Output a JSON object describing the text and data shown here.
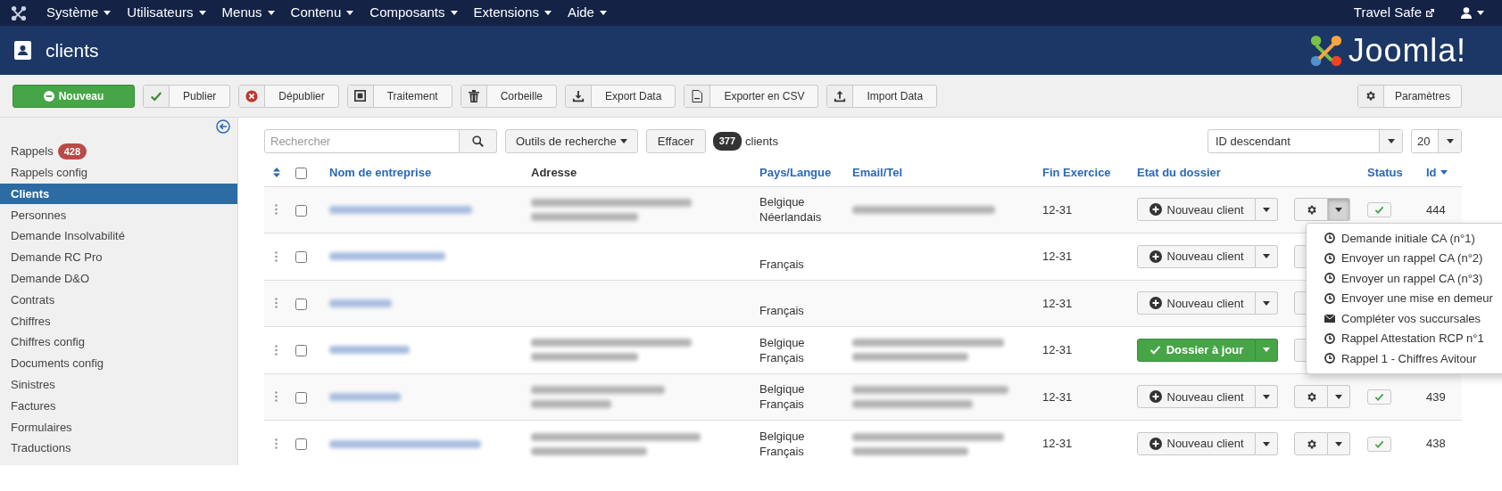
{
  "topnav": {
    "menus": [
      "Système",
      "Utilisateurs",
      "Menus",
      "Contenu",
      "Composants",
      "Extensions",
      "Aide"
    ],
    "site_link": "Travel Safe"
  },
  "header": {
    "title": "clients",
    "logo_text": "Joomla!"
  },
  "toolbar": {
    "buttons": [
      {
        "kind": "new",
        "label": "Nouveau"
      },
      {
        "kind": "publish",
        "label": "Publier"
      },
      {
        "kind": "unpublish",
        "label": "Dépublier"
      },
      {
        "kind": "batch",
        "label": "Traitement"
      },
      {
        "kind": "trash",
        "label": "Corbeille"
      },
      {
        "kind": "download",
        "label": "Export Data"
      },
      {
        "kind": "file",
        "label": "Exporter en CSV"
      },
      {
        "kind": "upload",
        "label": "Import Data"
      }
    ],
    "options": "Paramètres"
  },
  "sidebar": {
    "items": [
      {
        "label": "Rappels",
        "badge": "428",
        "selected": false
      },
      {
        "label": "Rappels config",
        "selected": false
      },
      {
        "label": "Clients",
        "selected": true
      },
      {
        "label": "Personnes",
        "selected": false
      },
      {
        "label": "Demande Insolvabilité",
        "selected": false
      },
      {
        "label": "Demande RC Pro",
        "selected": false
      },
      {
        "label": "Demande D&O",
        "selected": false
      },
      {
        "label": "Contrats",
        "selected": false
      },
      {
        "label": "Chiffres",
        "selected": false
      },
      {
        "label": "Chiffres config",
        "selected": false
      },
      {
        "label": "Documents config",
        "selected": false
      },
      {
        "label": "Sinistres",
        "selected": false
      },
      {
        "label": "Factures",
        "selected": false
      },
      {
        "label": "Formulaires",
        "selected": false
      },
      {
        "label": "Traductions",
        "selected": false
      }
    ]
  },
  "filters": {
    "search_placeholder": "Rechercher",
    "tools": "Outils de recherche",
    "clear": "Effacer",
    "count": "377",
    "count_label": "clients",
    "ordering": "ID descendant",
    "limit": "20"
  },
  "table": {
    "select_all_checked": false,
    "columns": [
      "Nom de entreprise",
      "Adresse",
      "Pays/Langue",
      "Email/Tel",
      "Fin Exercice",
      "Etat du dossier",
      "Status",
      "Id"
    ],
    "rows": [
      {
        "company": {
          "kind": "redacted-one-line"
        },
        "address": {
          "kind": "redacted-two-lines"
        },
        "country": "Belgique",
        "language": "Néerlandais",
        "email": {
          "kind": "redacted-one-line"
        },
        "fin": "12-31",
        "state": {
          "kind": "new",
          "label": "Nouveau client"
        },
        "published": true,
        "id": "444",
        "checked": false,
        "settings_menu_open": true
      },
      {
        "company": {
          "kind": "redacted-one-line"
        },
        "language": "Français",
        "fin": "12-31",
        "state": {
          "kind": "new",
          "label": "Nouveau client"
        },
        "checked": false
      },
      {
        "company": {
          "kind": "redacted-one-line"
        },
        "language": "Français",
        "fin": "12-31",
        "state": {
          "kind": "new",
          "label": "Nouveau client"
        },
        "checked": false
      },
      {
        "company": {
          "kind": "redacted-one-line"
        },
        "address": {
          "kind": "redacted-two-lines"
        },
        "country": "Belgique",
        "language": "Français",
        "email": {
          "kind": "redacted-two-lines"
        },
        "fin": "12-31",
        "state": {
          "kind": "done",
          "label": "Dossier à jour"
        },
        "checked": false
      },
      {
        "company": {
          "kind": "redacted-one-line"
        },
        "address": {
          "kind": "redacted-two-lines"
        },
        "country": "Belgique",
        "language": "Français",
        "email": {
          "kind": "redacted-two-lines"
        },
        "fin": "12-31",
        "state": {
          "kind": "new",
          "label": "Nouveau client"
        },
        "published": true,
        "id": "439",
        "checked": false,
        "settings_menu_open": false
      },
      {
        "company": {
          "kind": "redacted-one-line"
        },
        "address": {
          "kind": "redacted-two-lines"
        },
        "country": "Belgique",
        "language": "Français",
        "email": {
          "kind": "redacted-two-lines"
        },
        "fin": "12-31",
        "state": {
          "kind": "new",
          "label": "Nouveau client"
        },
        "published": true,
        "id": "438",
        "checked": false,
        "settings_menu_open": false
      }
    ]
  },
  "actions_menu": {
    "items": [
      {
        "kind": "clock",
        "label": "Demande initiale CA (n°1)"
      },
      {
        "kind": "clock",
        "label": "Envoyer un rappel CA (n°2)"
      },
      {
        "kind": "clock",
        "label": "Envoyer un rappel CA (n°3)"
      },
      {
        "kind": "clock",
        "label": "Envoyer une mise en demeur"
      },
      {
        "kind": "mail",
        "label": "Compléter vos succursales"
      },
      {
        "kind": "clock",
        "label": "Rappel Attestation RCP n°1"
      },
      {
        "kind": "clock",
        "label": "Rappel 1 - Chiffres Avitour"
      }
    ]
  }
}
